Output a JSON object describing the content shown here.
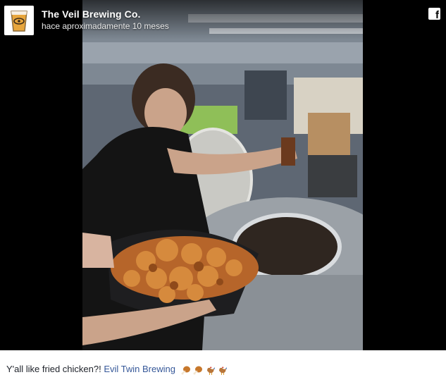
{
  "post": {
    "page_name": "The Veil Brewing Co.",
    "timestamp": "hace aproximadamente 10 meses",
    "caption_text": "Y'all like fried chicken?! ",
    "mention": "Evil Twin Brewing",
    "emojis": [
      "poultry-leg-icon",
      "poultry-leg-icon",
      "rooster-icon",
      "rooster-icon"
    ]
  },
  "icons": {
    "share": "facebook-icon"
  },
  "colors": {
    "link": "#365899",
    "text": "#1d2129",
    "background": "#000000"
  }
}
